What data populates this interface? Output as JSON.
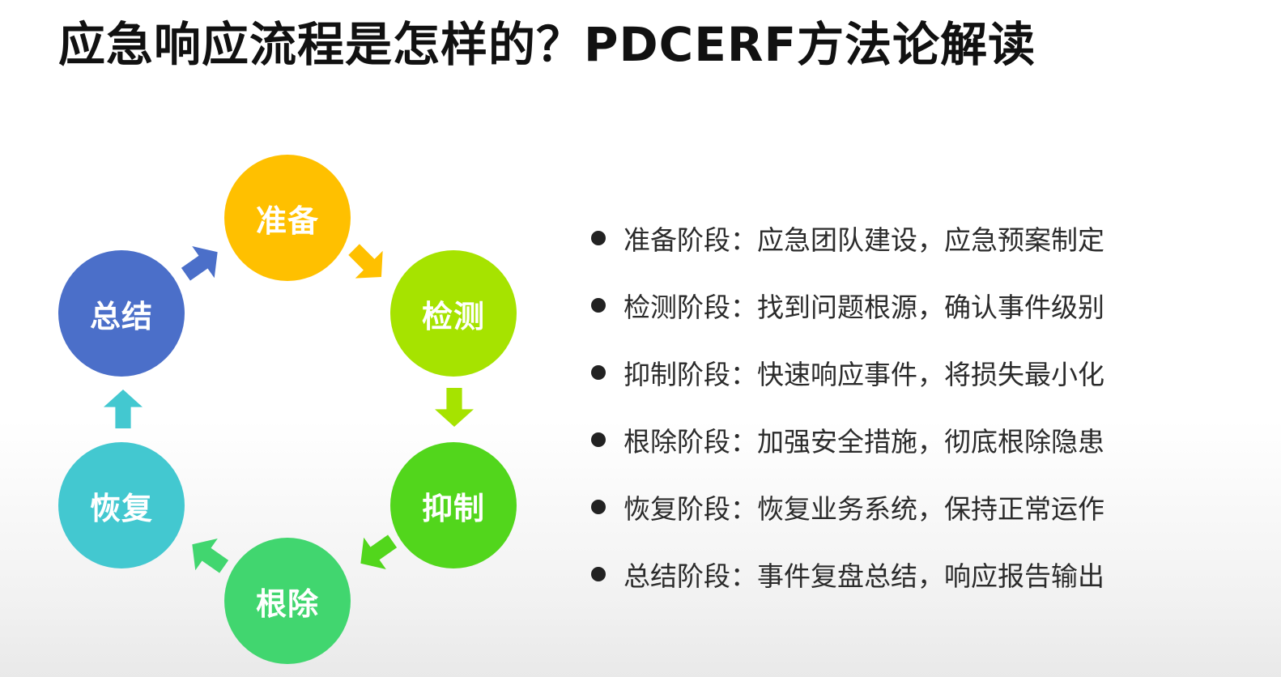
{
  "title": "应急响应流程是怎样的？PDCERF方法论解读",
  "diagram": {
    "nodes": [
      {
        "label": "准备",
        "color": "#FFC000"
      },
      {
        "label": "检测",
        "color": "#A6E300"
      },
      {
        "label": "抑制",
        "color": "#52D61C"
      },
      {
        "label": "根除",
        "color": "#41D66F"
      },
      {
        "label": "恢复",
        "color": "#43C8D0"
      },
      {
        "label": "总结",
        "color": "#4B6FC9"
      }
    ],
    "arrow_colors": {
      "prep_to_detect": "#FFC000",
      "detect_to_contain": "#A6E300",
      "contain_to_eradicate": "#52D61C",
      "eradicate_to_recover": "#41D66F",
      "recover_to_summary": "#43C8D0",
      "summary_to_prep": "#4B6FC9"
    }
  },
  "stages": [
    "准备阶段：应急团队建设，应急预案制定",
    "检测阶段：找到问题根源，确认事件级别",
    "抑制阶段：快速响应事件，将损失最小化",
    "根除阶段：加强安全措施，彻底根除隐患",
    "恢复阶段：恢复业务系统，保持正常运作",
    "总结阶段：事件复盘总结，响应报告输出"
  ]
}
